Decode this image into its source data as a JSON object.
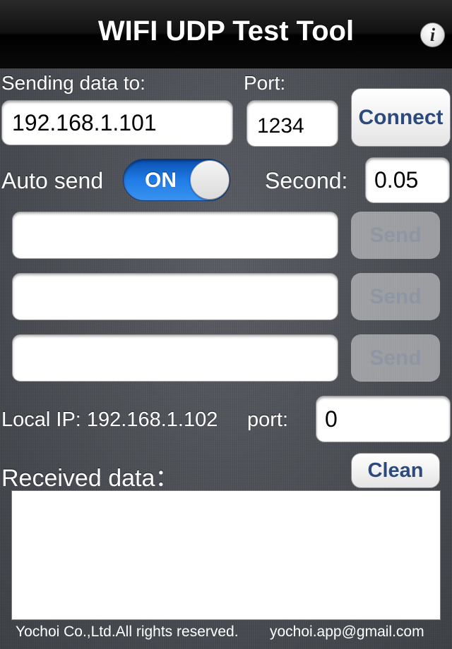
{
  "header": {
    "title": "WIFI UDP Test Tool",
    "info_icon": "i"
  },
  "send": {
    "label": "Sending data to:",
    "ip_value": "192.168.1.101",
    "port_label": "Port:",
    "port_value": "1234",
    "connect_label": "Connect"
  },
  "auto_send": {
    "label": "Auto send",
    "toggle_state": "ON",
    "second_label": "Second:",
    "second_value": "0.05"
  },
  "messages": [
    {
      "value": "",
      "send_label": "Send"
    },
    {
      "value": "",
      "send_label": "Send"
    },
    {
      "value": "",
      "send_label": "Send"
    }
  ],
  "local": {
    "ip_label": "Local IP: 192.168.1.102",
    "port_label": "port:",
    "port_value": "0"
  },
  "received": {
    "label": "Received data：",
    "clean_label": "Clean",
    "content": ""
  },
  "footer": {
    "copyright": "Yochoi Co.,Ltd.All rights reserved.",
    "email": "yochoi.app@gmail.com"
  }
}
